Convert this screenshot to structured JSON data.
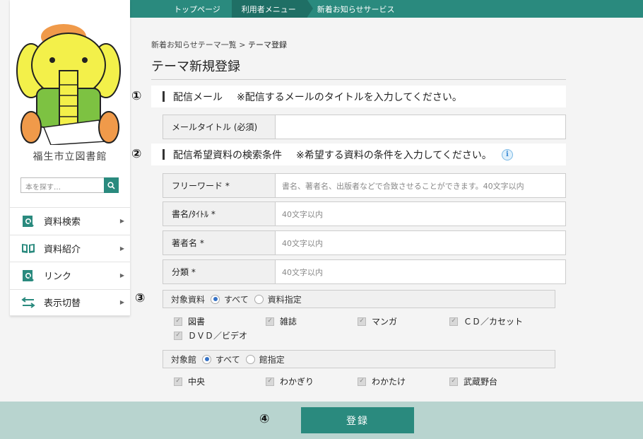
{
  "topnav": [
    "トップページ",
    "利用者メニュー",
    "新着お知らせサービス"
  ],
  "sidebar": {
    "library_name": "福生市立図書館",
    "search_placeholder": "本を探す…",
    "items": [
      {
        "label": "資料検索",
        "icon": "book-search-icon"
      },
      {
        "label": "資料紹介",
        "icon": "open-book-icon"
      },
      {
        "label": "リンク",
        "icon": "link-search-icon"
      },
      {
        "label": "表示切替",
        "icon": "switch-arrows-icon"
      }
    ]
  },
  "breadcrumb": {
    "parent": "新着お知らせテーマ一覧",
    "separator": ">",
    "current": "テーマ登録"
  },
  "page_title": "テーマ新規登録",
  "steps": [
    "①",
    "②",
    "③",
    "④"
  ],
  "section1": {
    "title": "配信メール",
    "note": "※配信するメールのタイトルを入力してください。"
  },
  "mail_title": {
    "label": "メールタイトル (必須)",
    "value": ""
  },
  "section2": {
    "title": "配信希望資料の検索条件",
    "note": "※希望する資料の条件を入力してください。",
    "info_icon": "i"
  },
  "fields": [
    {
      "label": "フリーワード *",
      "placeholder": "書名、著者名、出版者などで合致させることができます。40文字以内"
    },
    {
      "label": "書名/ﾀｲﾄﾙ *",
      "placeholder": "40文字以内"
    },
    {
      "label": "著者名 *",
      "placeholder": "40文字以内"
    },
    {
      "label": "分類 *",
      "placeholder": "40文字以内"
    }
  ],
  "material": {
    "label": "対象資料",
    "options": [
      {
        "label": "すべて",
        "selected": true
      },
      {
        "label": "資料指定",
        "selected": false
      }
    ],
    "checks": [
      "図書",
      "雑誌",
      "マンガ",
      "ＣＤ／カセット",
      "ＤＶＤ／ビデオ"
    ]
  },
  "library": {
    "label": "対象館",
    "options": [
      {
        "label": "すべて",
        "selected": true
      },
      {
        "label": "館指定",
        "selected": false
      }
    ],
    "checks": [
      "中央",
      "わかぎり",
      "わかたけ",
      "武蔵野台"
    ]
  },
  "submit_label": "登録",
  "colors": {
    "accent": "#2a8a7e",
    "footer": "#b8d4cf",
    "radio": "#3572c6"
  }
}
